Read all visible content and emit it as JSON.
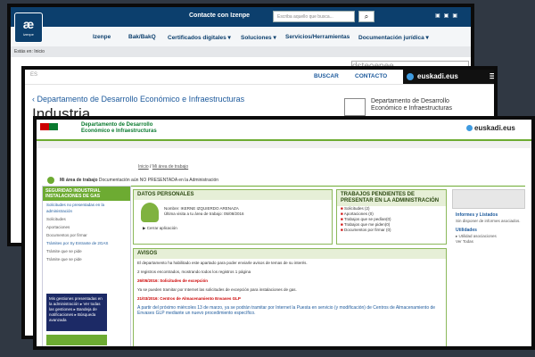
{
  "izenpe": {
    "logo_text": "æ",
    "logo_sub": "izenpe",
    "contact": "Contacte con Izenpe",
    "search_placeholder": "Escriba aquello que busca...",
    "nav": [
      "Izenpe",
      "Bak/BakQ",
      "Certificados digitales ▾",
      "Soluciones ▾",
      "Servicios/Herramientas",
      "Documentación jurídica ▾"
    ],
    "crumb": "Estás en:  Inicio",
    "hint": "dsteoepee"
  },
  "euskadi": {
    "lang": "ES",
    "buscar": "BUSCAR",
    "contacto": "CONTACTO",
    "brand": "euskadi.eus",
    "dept_link": "‹ Departamento de Desarrollo Económico e Infraestructuras",
    "section_title": "Industria",
    "gov_line1": "Departamento de Desarrollo",
    "gov_line2": "Económico e Infraestructuras"
  },
  "app": {
    "header_line1": "Departamento de Desarrollo",
    "header_line2": "Económico e Infraestructuras",
    "brand": "euskadi.eus",
    "crumb_home": "Inicio",
    "crumb_sep": "/",
    "crumb_current": "Mi área de trabajo",
    "area_title": "Mi área de trabajo",
    "area_text": "Documentación aún NO PRESENTADA en la Administración",
    "left_head": "SEGURIDAD INDUSTRIAL INSTALACIONES DE GAS",
    "left_items": [
      "Solicitudes no presentadas en la administración",
      "Solicitudes",
      "Aportaciones",
      "Documentos por firmar",
      "Trámites por Sy Entrante de 2GAS",
      "Trámite que se pide",
      "Trámite que se pide"
    ],
    "left_box": "Mis gestiones presentadas en la administración  ▸ Ver todas las gestiones  ▸ Bandeja de notificaciones  ▸ Búsqueda avanzada",
    "panel1_title": "DATOS PERSONALES",
    "panel1_info": "Nombre: IKERNE IZQUIERDO ARENAZA",
    "panel1_info2": "Última visita a tu área de trabajo: 05/08/2016",
    "panel1_link": "▶ Cerrar aplicación",
    "panel2_title": "TRABAJOS PENDIENTES DE PRESENTAR EN LA ADMINISTRACIÓN",
    "panel2_items": [
      "Solicitudes (2)",
      "Aportaciones (0)",
      "Trabajos que se pedían(0)",
      "Trabajos que me piden(0)",
      "Documentos por firmar (0)"
    ],
    "panel3_title": "AVISOS",
    "panel3_text1": "El departamento ha habilitado este apartado para poder enviarle avisos de temas de su interés.",
    "panel3_text2": "2 registros encontrados, mostrando todos los registros  1 página",
    "panel3_date1": "26/05/2016: Solicitudes de excepción",
    "panel3_text3": "Ya se pueden tramitar por Internet las solicitudes de excepción para instalaciones de gas.",
    "panel3_date2": "21/03/2016: Centros de Almacenamiento Envases GLP",
    "panel3_text4": "A partir del próximo miércoles 13 de marzo, ya se podrán tramitar por Internet la Puesta en servicio (y modificación) de Centros de Almacenamiento de Envases GLP mediante un nuevo procedimiento específico.",
    "right_h1": "Informes y Listados",
    "right_t1": "Sin disponer de informes asociados.",
    "right_h2": "Utilidades",
    "right_t2": "▸ Utilidad asociaciones",
    "right_t3": "Ver Todas"
  },
  "colors": {
    "izenpe_blue": "#0c3f6d",
    "euskadi_blue": "#1d5a9c",
    "app_green": "#6dab32",
    "alert_red": "#c00"
  }
}
